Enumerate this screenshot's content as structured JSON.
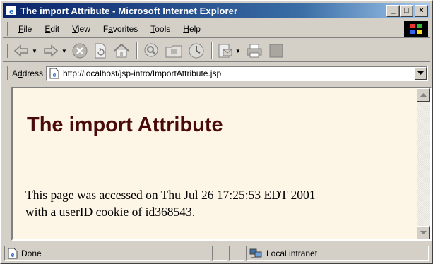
{
  "window": {
    "title": "The import Attribute - Microsoft Internet Explorer",
    "minimize_symbol": "_",
    "maximize_symbol": "□",
    "close_symbol": "×"
  },
  "menu": {
    "items": [
      {
        "underline": "F",
        "rest": "ile"
      },
      {
        "underline": "E",
        "rest": "dit"
      },
      {
        "underline": "V",
        "rest": "iew"
      },
      {
        "pre": "F",
        "underline": "a",
        "rest": "vorites"
      },
      {
        "underline": "T",
        "rest": "ools"
      },
      {
        "underline": "H",
        "rest": "elp"
      }
    ]
  },
  "toolbar": {
    "icons": [
      "back-icon",
      "forward-icon",
      "stop-icon",
      "refresh-icon",
      "home-icon",
      "search-icon",
      "favorites-icon",
      "history-icon",
      "mail-icon",
      "print-icon",
      "edit-icon"
    ]
  },
  "address": {
    "label_pre": "A",
    "label_underline": "d",
    "label_rest": "dress",
    "url": "http://localhost/jsp-intro/ImportAttribute.jsp"
  },
  "page": {
    "heading": "The import Attribute",
    "line1": "This page was accessed on Thu Jul 26 17:25:53 EDT 2001",
    "line2": "with a userID cookie of id368543."
  },
  "status": {
    "text": "Done",
    "zone": "Local intranet"
  },
  "colors": {
    "titlebar_start": "#0a246a",
    "titlebar_end": "#a6caf0",
    "page_background": "#fdf5e6",
    "heading_color": "#4a0a0a",
    "chrome": "#d4d0c8"
  }
}
